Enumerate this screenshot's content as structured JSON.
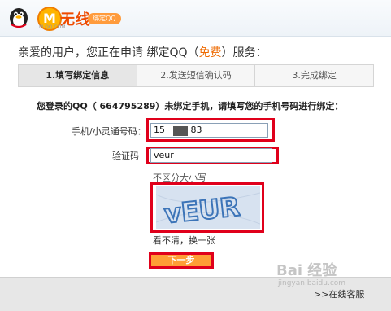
{
  "brand": {
    "m_letter": "M",
    "title": "无线",
    "url": "M.QQ.COM",
    "badge": "绑定QQ"
  },
  "greeting": {
    "prefix": "亲爱的用户，您正在申请 绑定QQ（",
    "free": "免费",
    "suffix": "）服务："
  },
  "tabs": [
    {
      "label": "1.填写绑定信息",
      "active": true
    },
    {
      "label": "2.发送短信确认码",
      "active": false
    },
    {
      "label": "3.完成绑定",
      "active": false
    }
  ],
  "notice": "您登录的QQ（ 664795289）未绑定手机，请填写您的手机号码进行绑定：",
  "form": {
    "phone_label": "手机/小灵通号码：",
    "phone_value": "15         83",
    "captcha_label": "验证码",
    "captcha_value": "veur",
    "case_hint": "不区分大小写",
    "captcha_text": "vEUR",
    "refresh_label": "看不清，换一张",
    "next_label": "下一步"
  },
  "footer": {
    "service_link": ">>在线客服"
  },
  "watermark": {
    "main": "Bai 经验",
    "sub": "jingyan.baidu.com"
  },
  "colors": {
    "highlight": "#e0001b",
    "button": "#ff9e35",
    "accent": "#ee6a00"
  }
}
